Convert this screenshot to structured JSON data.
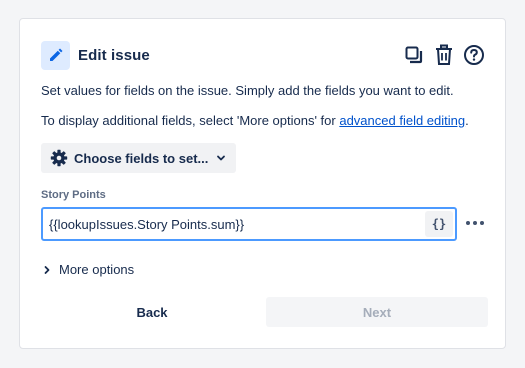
{
  "panel": {
    "title": "Edit issue",
    "description": "Set values for fields on the issue. Simply add the fields you want to edit.",
    "additional_prefix": "To display additional fields, select 'More options' for ",
    "additional_link": "advanced field editing",
    "additional_suffix": "."
  },
  "icons": {
    "header": "pencil-icon",
    "actions": [
      "duplicate-icon",
      "trash-icon",
      "help-icon"
    ]
  },
  "choose_fields": {
    "label": "Choose fields to set..."
  },
  "field": {
    "label": "Story Points",
    "value": "{{lookupIssues.Story Points.sum}}",
    "smart_value_label": "{}"
  },
  "more_options": {
    "label": "More options"
  },
  "footer": {
    "back_label": "Back",
    "next_label": "Next"
  },
  "colors": {
    "accent": "#0052cc",
    "focus_border": "#4c9aff",
    "icon_bg": "#deebff"
  }
}
